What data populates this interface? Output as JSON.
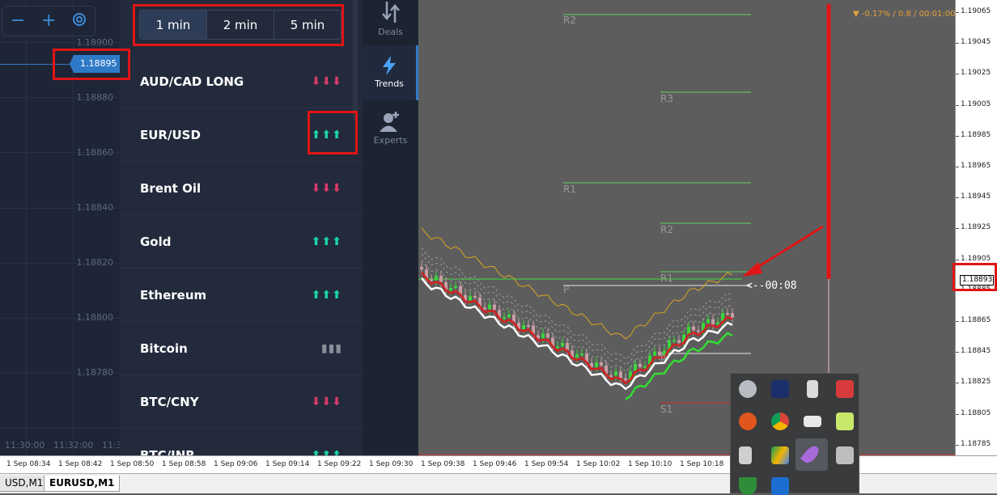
{
  "olymp": {
    "zoom": {
      "minus_label": "−",
      "plus_label": "+"
    },
    "left_chart": {
      "price_labels": [
        "1.18900",
        "1.18880",
        "1.18860",
        "1.18840",
        "1.18820",
        "1.18800",
        "1.18780"
      ],
      "current_price": "1.18895",
      "time_labels": [
        "11:30:00",
        "11:32:00",
        "11:3"
      ]
    },
    "trends": {
      "tabs": [
        "1 min",
        "2 min",
        "5 min"
      ],
      "selected_tab": "1 min",
      "items": [
        {
          "name": "AUD/CAD LONG",
          "direction": "down",
          "arrows": "⬇⬇⬇"
        },
        {
          "name": "EUR/USD",
          "direction": "up",
          "arrows": "⬆⬆⬆"
        },
        {
          "name": "Brent Oil",
          "direction": "down",
          "arrows": "⬇⬇⬇"
        },
        {
          "name": "Gold",
          "direction": "up",
          "arrows": "⬆⬆⬆"
        },
        {
          "name": "Ethereum",
          "direction": "up",
          "arrows": "⬆⬆⬆"
        },
        {
          "name": "Bitcoin",
          "direction": "neutral",
          "arrows": "▮▮▮"
        },
        {
          "name": "BTC/CNY",
          "direction": "down",
          "arrows": "⬇⬇⬇"
        },
        {
          "name": "BTC/INR",
          "direction": "up",
          "arrows": "⬆⬆⬆"
        }
      ]
    },
    "nav": [
      {
        "label": "Deals",
        "icon": "deals-icon"
      },
      {
        "label": "Trends",
        "icon": "lightning-icon",
        "active": true
      },
      {
        "label": "Experts",
        "icon": "add-user-icon"
      }
    ],
    "colors": {
      "up": "#1dd3a5",
      "down": "#d83a6b",
      "accent": "#2f7ac7"
    }
  },
  "mt4": {
    "info": "▼ -0.17% / 0.8 / 00:01:00",
    "levels": [
      "R2",
      "R3",
      "R1",
      "R2",
      "R1",
      "P",
      "P",
      "S1"
    ],
    "countdown": "<--00:08",
    "current_price": "1.18893",
    "price_axis": [
      "1.19065",
      "1.19045",
      "1.19025",
      "1.19005",
      "1.18985",
      "1.18965",
      "1.18945",
      "1.18925",
      "1.18905",
      "1.18885",
      "1.18865",
      "1.18845",
      "1.18825",
      "1.18805",
      "1.18785"
    ],
    "time_axis": [
      "1 Sep 08:34",
      "1 Sep 08:42",
      "1 Sep 08:50",
      "1 Sep 08:58",
      "1 Sep 09:06",
      "1 Sep 09:14",
      "1 Sep 09:22",
      "1 Sep 09:30",
      "1 Sep 09:38",
      "1 Sep 09:46",
      "1 Sep 09:54",
      "1 Sep 10:02",
      "1 Sep 10:10",
      "1 Sep 10:18"
    ],
    "window_tabs": [
      "USD,M1",
      "EURUSD,M1"
    ],
    "active_tab": "EURUSD,M1"
  },
  "tray": {
    "icons": [
      "cloud-icon",
      "monitor-icon",
      "lock-icon",
      "flag-icon",
      "ccleaner-icon",
      "chrome-icon",
      "battery-icon",
      "lime-icon",
      "volume-icon",
      "drive-icon",
      "feather-icon",
      "display-icon",
      "shield-icon",
      "app-icon"
    ]
  }
}
